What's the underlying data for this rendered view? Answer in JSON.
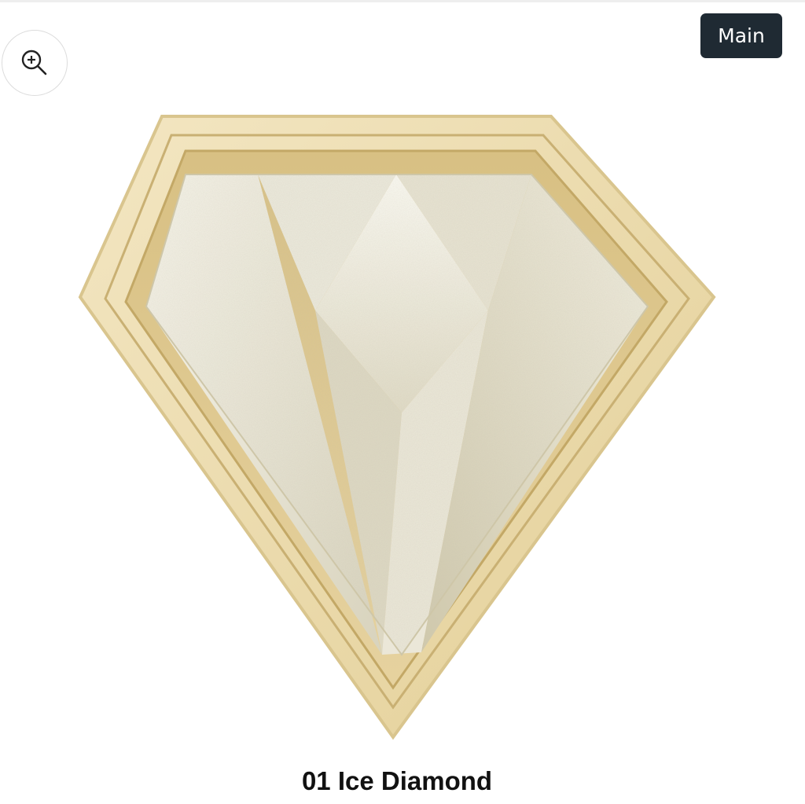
{
  "zoom": {
    "icon": "zoom-in-magnifier-icon"
  },
  "badge": {
    "label": "Main",
    "background": "#1f2a33"
  },
  "product": {
    "caption": "01 Ice Diamond",
    "case_color": "#e8d6a6",
    "powder_color": "#e9e6d6"
  }
}
